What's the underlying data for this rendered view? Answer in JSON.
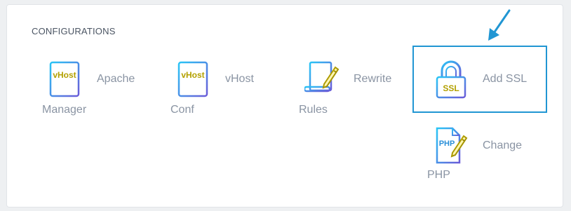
{
  "section": {
    "title": "CONFIGURATIONS"
  },
  "items": [
    {
      "label_line1": "Apache",
      "label_line2": "Manager",
      "icon_text": "vHost",
      "icon": "vhost-document-icon"
    },
    {
      "label_line1": "vHost",
      "label_line2": "Conf",
      "icon_text": "vHost",
      "icon": "vhost-document-icon"
    },
    {
      "label_line1": "Rewrite",
      "label_line2": "Rules",
      "icon": "document-pencil-icon"
    },
    {
      "label_line1": "Add SSL",
      "label_line2": "",
      "icon_text": "SSL",
      "icon": "padlock-icon"
    },
    {
      "label_line1": "Change",
      "label_line2": "PHP",
      "icon_text": "PHP",
      "icon": "php-file-pencil-icon"
    }
  ],
  "colors": {
    "icon_gradient_start": "#29c5f6",
    "icon_gradient_end": "#6a5bd8",
    "icon_text": "#b3a000",
    "highlight": "#2196d3",
    "label": "#8a94a3"
  }
}
